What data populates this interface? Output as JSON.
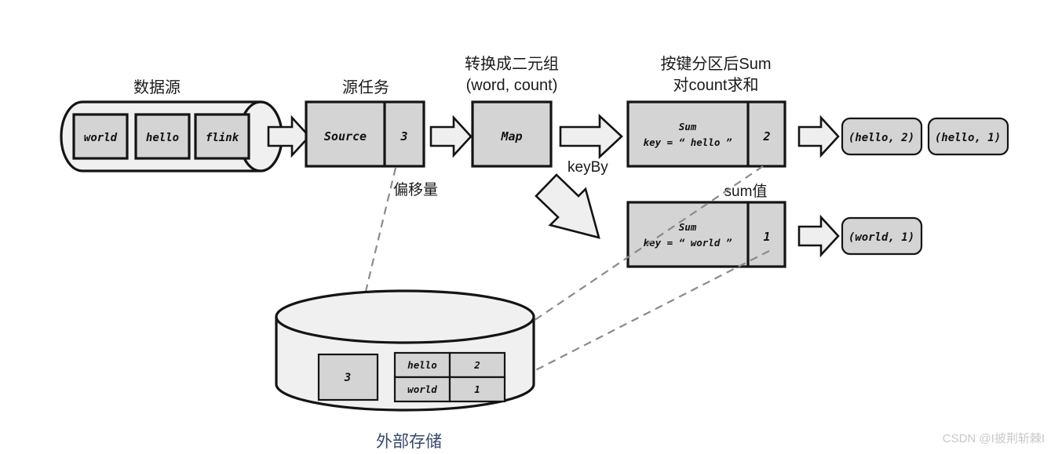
{
  "diagram": {
    "title_watermark": "CSDN @I披荆斩棘I",
    "labels": {
      "data_source": "数据源",
      "source_task": "源任务",
      "offset": "偏移量",
      "map_title_line1": "转换成二元组",
      "map_title_line2": "(word, count)",
      "sum_title_line1": "按键分区后Sum",
      "sum_title_line2": "对count求和",
      "keyby": "keyBy",
      "sum_value": "sum值",
      "external_storage": "外部存储"
    },
    "source_records": [
      {
        "text": "world"
      },
      {
        "text": "hello"
      },
      {
        "text": "flink"
      }
    ],
    "source_task": {
      "name": "Source",
      "offset_value": "3"
    },
    "map_task": {
      "name": "Map"
    },
    "sum_tasks": [
      {
        "name": "Sum",
        "key_expr": "key = “ hello ”",
        "value": "2"
      },
      {
        "name": "Sum",
        "key_expr": "key = “ world ”",
        "value": "1"
      }
    ],
    "outputs_top": [
      {
        "text": "(hello, 2)"
      },
      {
        "text": "(hello, 1)"
      }
    ],
    "outputs_bottom": [
      {
        "text": "(world, 1)"
      }
    ],
    "storage": {
      "offset_cell": "3",
      "state_table": [
        {
          "key": "hello",
          "value": "2"
        },
        {
          "key": "world",
          "value": "1"
        }
      ]
    },
    "colors": {
      "box_fill": "#d4d4d4",
      "cylinder_fill": "#f0f0f0",
      "stroke": "#141414",
      "dashed": "#8a8a8a",
      "storage_label": "#38496e",
      "watermark": "#c8c8c8"
    }
  }
}
